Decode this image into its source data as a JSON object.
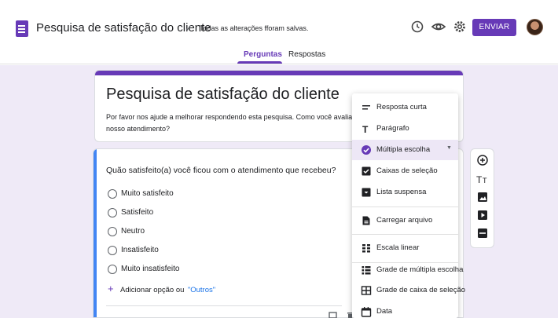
{
  "header": {
    "doc_title": "Pesquisa de satisfação do cliente",
    "save_status": "Todas as alterações fforam salvas.",
    "send_label": "ENVIAR"
  },
  "tabs": [
    {
      "label": "Perguntas",
      "active": true
    },
    {
      "label": "Respostas",
      "active": false
    }
  ],
  "form": {
    "title": "Pesquisa de satisfação do cliente",
    "description": "Por favor nos ajude a melhorar respondendo esta pesquisa. Como você avalia nosso atendimento?"
  },
  "question": {
    "text": "Quão satisfeito(a) você ficou com o atendimento que recebeu?",
    "options": [
      "Muito satisfeito",
      "Satisfeito",
      "Neutro",
      "Insatisfeito",
      "Muito insatisfeito"
    ],
    "add_option": "Adicionar opção ou",
    "add_other": "\"Outros\""
  },
  "type_menu": {
    "items": [
      {
        "label": "Resposta curta",
        "icon": "short-answer-icon"
      },
      {
        "label": "Parágrafo",
        "icon": "paragraph-icon"
      },
      {
        "label": "Múltipla escolha",
        "icon": "radio-checked-icon",
        "selected": true
      },
      {
        "label": "Caixas de seleção",
        "icon": "checkbox-icon"
      },
      {
        "label": "Lista suspensa",
        "icon": "dropdown-list-icon"
      },
      {
        "label": "Carregar arquivo",
        "icon": "upload-file-icon"
      },
      {
        "label": "Escala linear",
        "icon": "linear-scale-icon"
      },
      {
        "label": "Grade de múltipla escolha",
        "icon": "grid-icon"
      },
      {
        "label": "Grade de caixa de seleção",
        "icon": "checkbox-grid-icon"
      },
      {
        "label": "Data",
        "icon": "calendar-icon"
      }
    ]
  },
  "colors": {
    "accent": "#673ab7",
    "canvas": "#efeaf7",
    "question_highlight": "#4285f4"
  }
}
